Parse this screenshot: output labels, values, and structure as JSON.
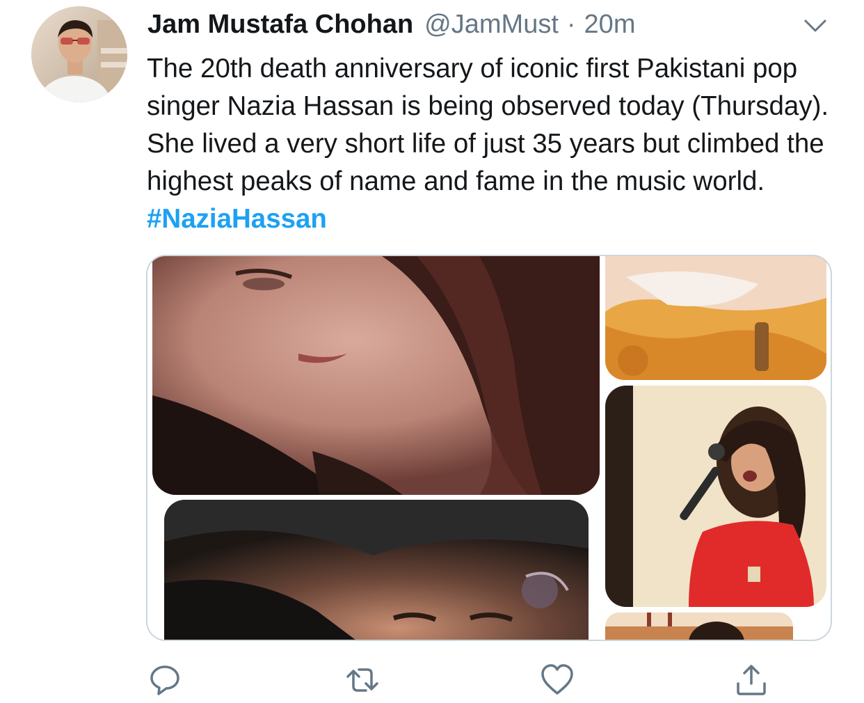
{
  "tweet": {
    "author_name": "Jam Mustafa Chohan",
    "handle": "@JamMust",
    "separator": "·",
    "time": "20m",
    "text": "The 20th death anniversary of iconic first Pakistani pop singer Nazia Hassan is being observed today (Thursday). She lived a very short life of just 35 years but climbed the highest peaks of name and fame in the music world.",
    "hashtag": "#NaziaHassan"
  },
  "icons": {
    "menu": "chevron-down-icon",
    "reply": "reply-icon",
    "retweet": "retweet-icon",
    "like": "heart-icon",
    "share": "share-icon"
  },
  "colors": {
    "text": "#14171a",
    "secondary": "#657786",
    "link": "#1da1f2",
    "border": "#ccd6dd"
  }
}
